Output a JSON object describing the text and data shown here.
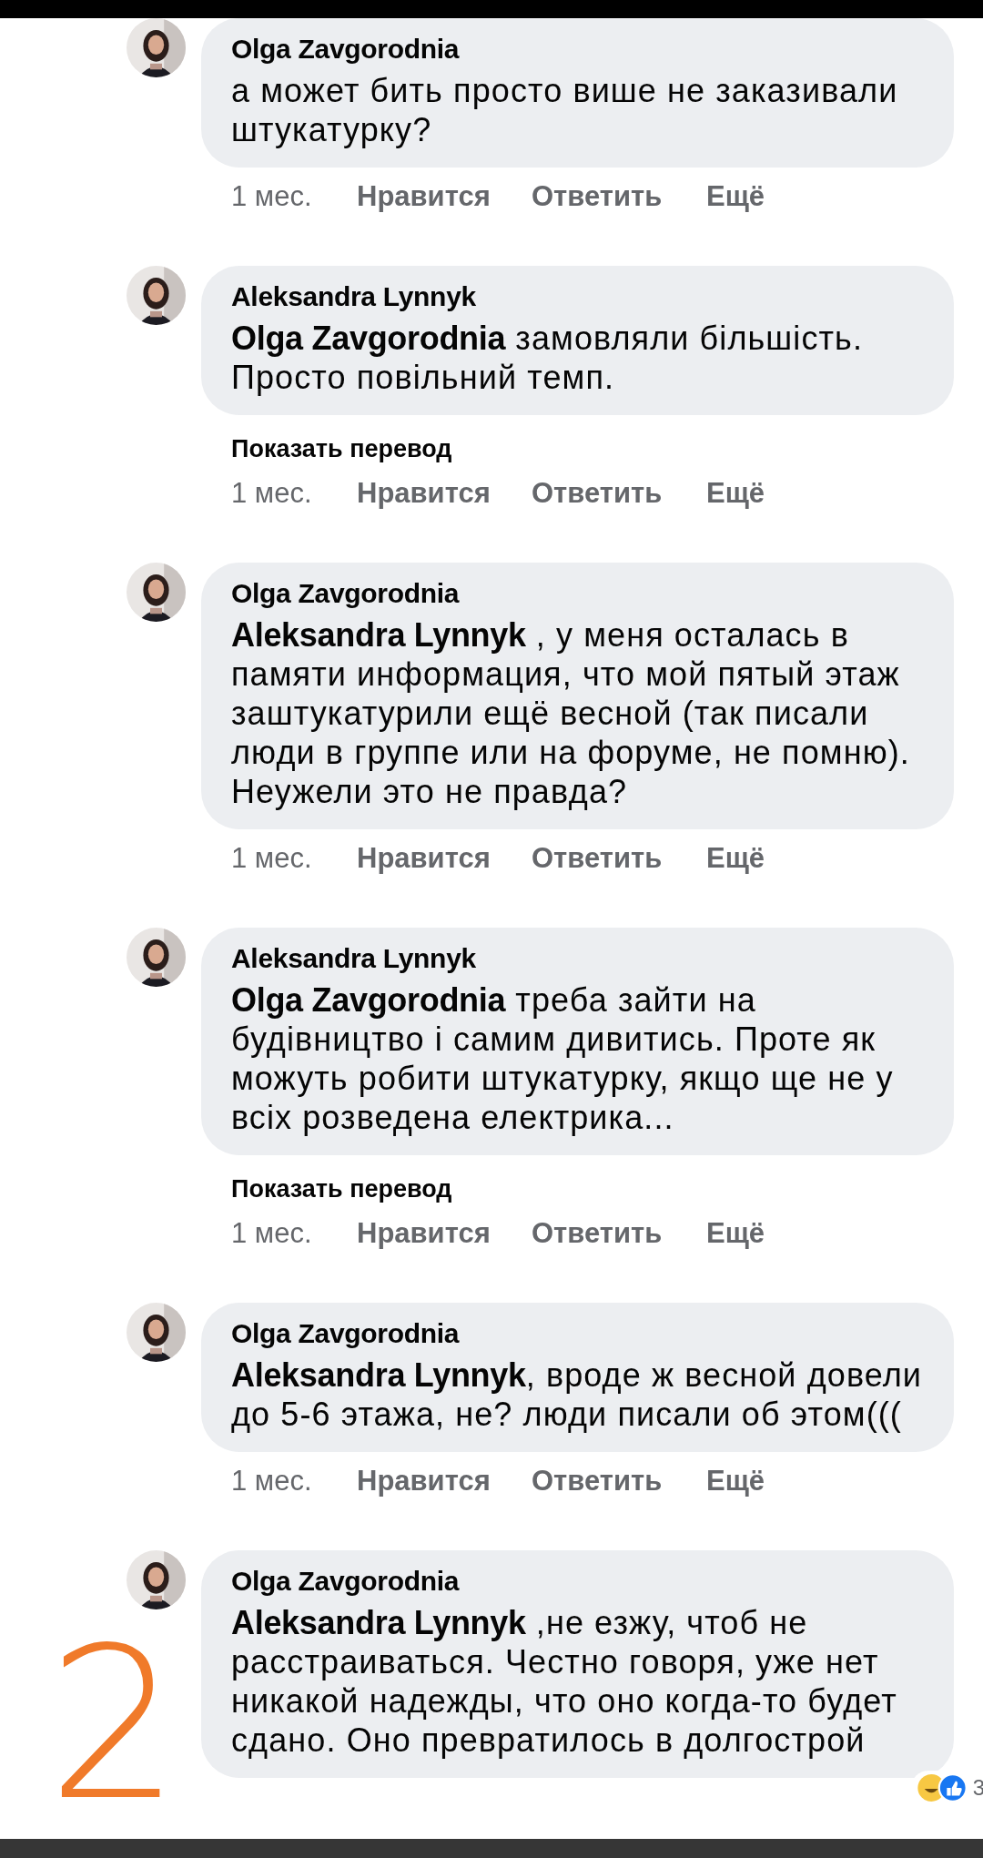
{
  "comments": [
    {
      "author": "Olga Zavgorodnia",
      "text": "а может бить просто више не заказивали штукатурку?",
      "time": "1 мес.",
      "actions": [
        "Нравится",
        "Ответить",
        "Ещё"
      ]
    },
    {
      "author": "Aleksandra Lynnyk",
      "text": "**Olga Zavgorodnia** замовляли більшість. Просто повільний темп.",
      "show_translation": "Показать перевод",
      "time": "1 мес.",
      "actions": [
        "Нравится",
        "Ответить",
        "Ещё"
      ]
    },
    {
      "author": "Olga Zavgorodnia",
      "text": "**Aleksandra Lynnyk** , у меня осталась в памяти информация, что мой пятый этаж заштукатурили ещё весной (так писали люди в группе или на форуме, не помню). Неужели это не правда?",
      "time": "1 мес.",
      "actions": [
        "Нравится",
        "Ответить",
        "Ещё"
      ]
    },
    {
      "author": "Aleksandra Lynnyk",
      "text": "**Olga Zavgorodnia** треба зайти на будівництво і самим дивитись. Проте як можуть робити штукатурку, якщо ще не у всіх розведена електрика...",
      "show_translation": "Показать перевод",
      "time": "1 мес.",
      "actions": [
        "Нравится",
        "Ответить",
        "Ещё"
      ]
    },
    {
      "author": "Olga Zavgorodnia",
      "text": "**Aleksandra Lynnyk**, вроде ж весной довели до 5-6 этажа, не? люди писали об этом(((",
      "time": "1 мес.",
      "actions": [
        "Нравится",
        "Ответить",
        "Ещё"
      ]
    },
    {
      "author": "Olga Zavgorodnia",
      "text": "**Aleksandra Lynnyk** ,не езжу, чтоб не расстраиваться. Честно говоря, уже нет никакой надежды, что оно когда-то будет сдано. Оно превратилось в долгострой",
      "reactions": {
        "count": "3"
      }
    }
  ],
  "annotation": {
    "text": "2"
  }
}
